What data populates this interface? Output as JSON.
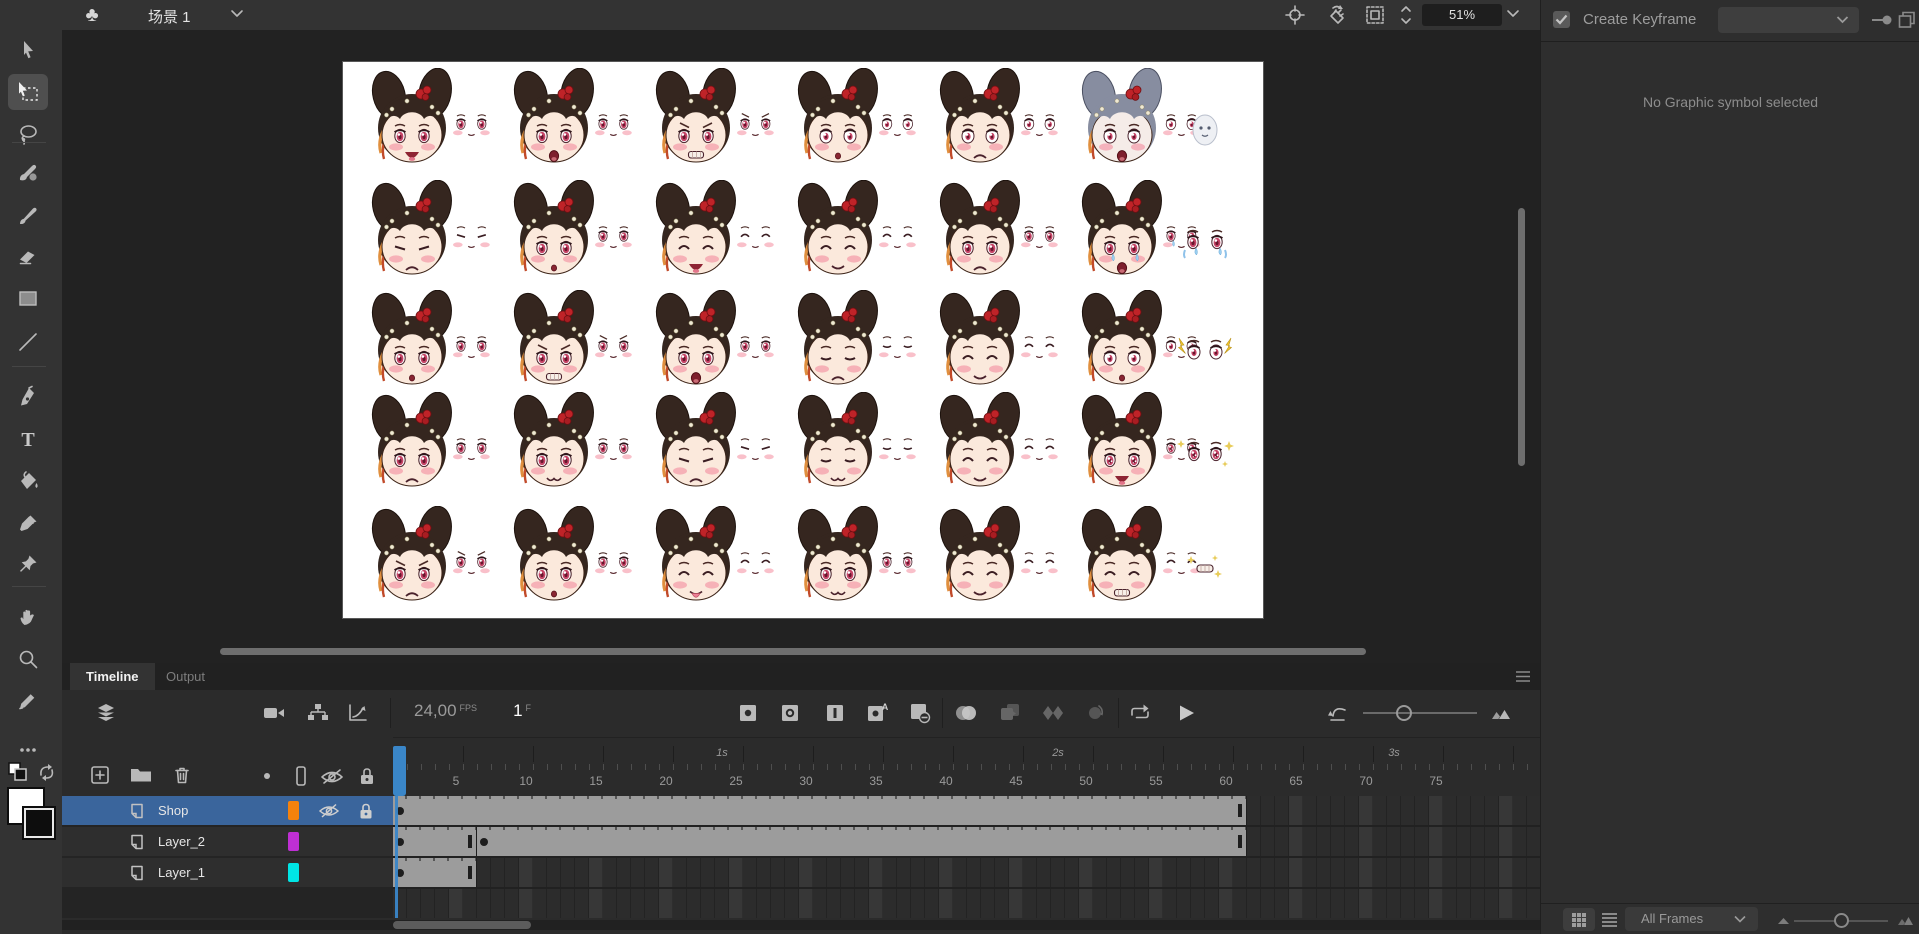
{
  "topbar": {
    "scene_name": "场景 1",
    "zoom_level": "51%"
  },
  "right_panel": {
    "create_keyframe_label": "Create Keyframe",
    "empty_message": "No Graphic symbol selected",
    "frames_filter": "All Frames"
  },
  "timeline": {
    "tabs": [
      {
        "label": "Timeline",
        "active": true
      },
      {
        "label": "Output",
        "active": false
      }
    ],
    "fps_value": "24,00",
    "fps_unit": "FPS",
    "current_frame": "1",
    "frame_unit": "F",
    "ruler": {
      "frame_labels": [
        5,
        10,
        15,
        20,
        25,
        30,
        35,
        40,
        45,
        50,
        55,
        60,
        65,
        70,
        75
      ],
      "seconds": [
        {
          "label": "1s",
          "frame": 24
        },
        {
          "label": "2s",
          "frame": 48
        },
        {
          "label": "3s",
          "frame": 72
        }
      ],
      "visible_frames": 82
    },
    "playhead_frame": 1,
    "layers": [
      {
        "name": "Shop",
        "color": "#f5820c",
        "selected": true,
        "hidden": true,
        "locked": true,
        "spans": [
          {
            "start": 1,
            "end": 61,
            "keyframe": true,
            "endbar": true
          }
        ]
      },
      {
        "name": "Layer_2",
        "color": "#bf2fd4",
        "selected": false,
        "hidden": false,
        "locked": false,
        "spans": [
          {
            "start": 1,
            "end": 6,
            "keyframe": true,
            "endbar": true
          },
          {
            "start": 7,
            "end": 61,
            "keyframe": true,
            "endbar": true
          }
        ]
      },
      {
        "name": "Layer_1",
        "color": "#00e5e5",
        "selected": false,
        "hidden": false,
        "locked": false,
        "spans": [
          {
            "start": 1,
            "end": 6,
            "keyframe": true,
            "endbar": true
          }
        ]
      }
    ]
  },
  "stage": {
    "description": "Sprite sheet of a chibi girl with dark double hair buns, red flower ornament and varied facial expressions; each head is paired with a detached eyes glyph",
    "rows": [
      {
        "cells": [
          {
            "e": "open",
            "m": "smile"
          },
          {
            "e": "open",
            "m": "open"
          },
          {
            "e": "angry",
            "m": "grit"
          },
          {
            "e": "wide",
            "m": "o"
          },
          {
            "e": "wide",
            "m": "frown"
          },
          {
            "e": "wide",
            "m": "open",
            "hair": "gray"
          }
        ],
        "extra": "ghost"
      },
      {
        "cells": [
          {
            "e": "squint",
            "m": "frown"
          },
          {
            "e": "open",
            "m": "o"
          },
          {
            "e": "happy",
            "m": "smile"
          },
          {
            "e": "happy",
            "m": "smilec"
          },
          {
            "e": "open",
            "m": "frown"
          },
          {
            "e": "cry",
            "m": "open"
          }
        ],
        "extra": "cry"
      },
      {
        "cells": [
          {
            "e": "open",
            "m": "o"
          },
          {
            "e": "angry",
            "m": "grit"
          },
          {
            "e": "open",
            "m": "open"
          },
          {
            "e": "closed",
            "m": "frown"
          },
          {
            "e": "happy",
            "m": "smilec"
          },
          {
            "e": "wide",
            "m": "o"
          }
        ],
        "extra": "lightning"
      },
      {
        "cells": [
          {
            "e": "open",
            "m": "frown"
          },
          {
            "e": "open",
            "m": "w"
          },
          {
            "e": "squint",
            "m": "frown"
          },
          {
            "e": "closed",
            "m": "w"
          },
          {
            "e": "happy",
            "m": "smilec"
          },
          {
            "e": "sparkle",
            "m": "smile"
          }
        ],
        "extra": "sparkle"
      },
      {
        "cells": [
          {
            "e": "angry",
            "m": "frown"
          },
          {
            "e": "open",
            "m": "o"
          },
          {
            "e": "happy",
            "m": "tongue"
          },
          {
            "e": "open",
            "m": "w"
          },
          {
            "e": "happy",
            "m": "smilec"
          },
          {
            "e": "happy",
            "m": "grit"
          }
        ],
        "extra": "mouth"
      }
    ]
  }
}
